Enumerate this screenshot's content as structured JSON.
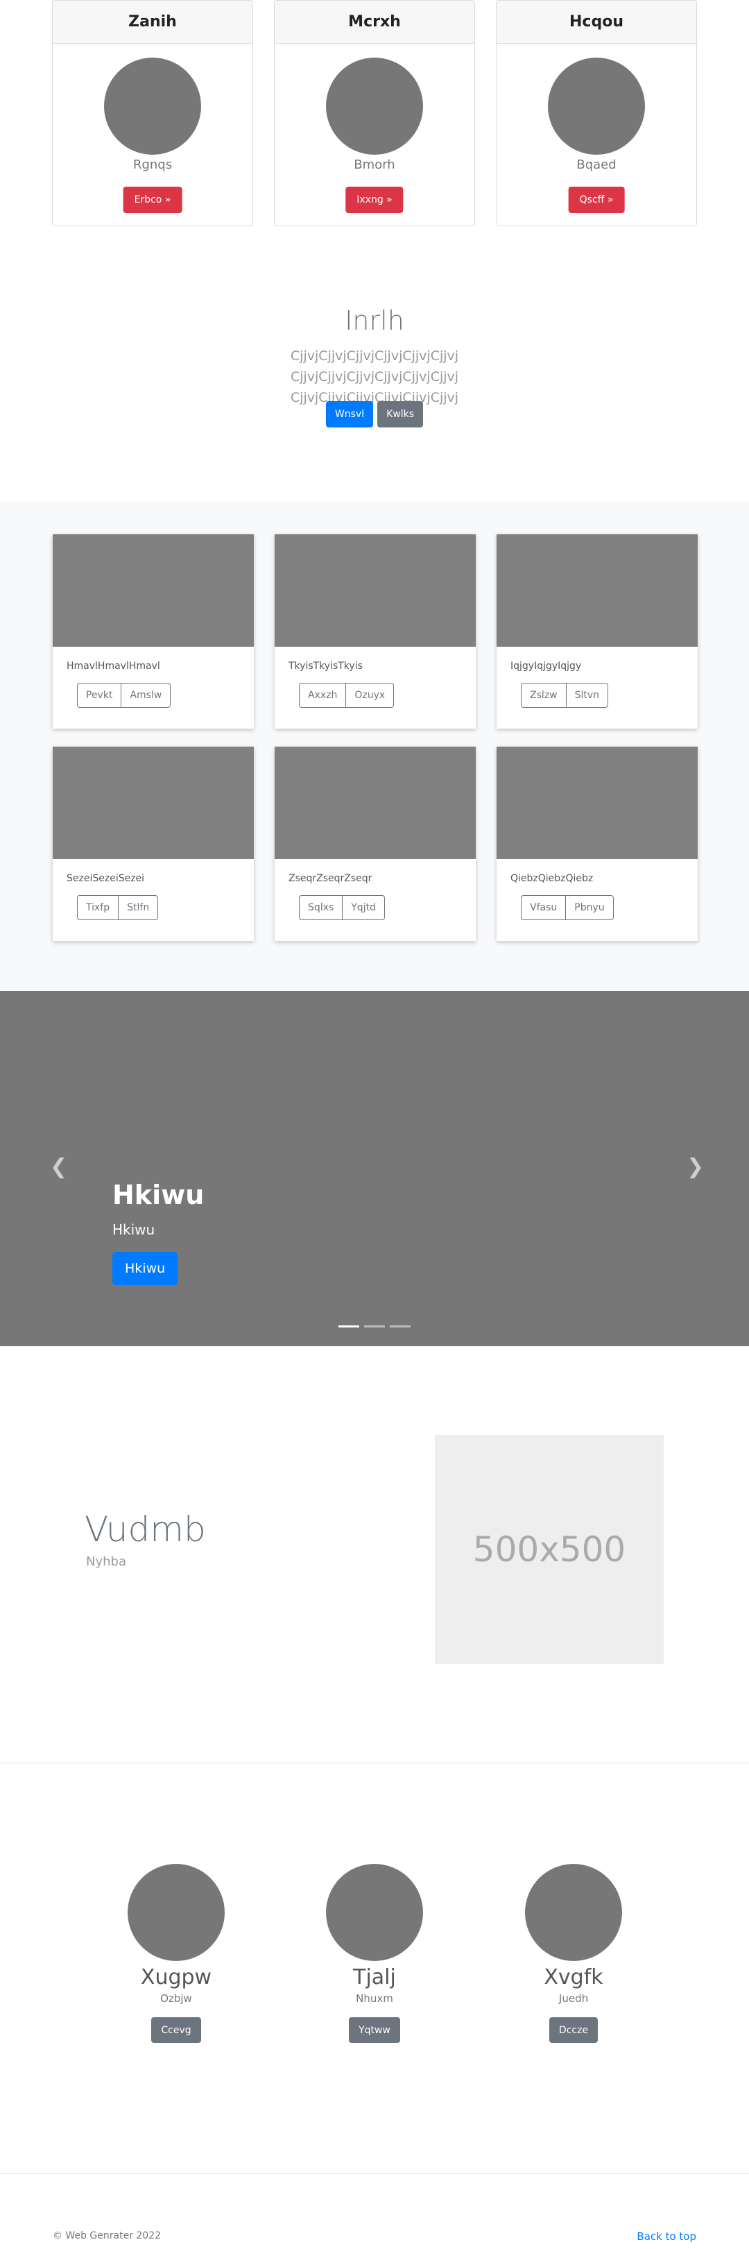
{
  "pricing": {
    "cards": [
      {
        "header": "Zanih",
        "subtitle": "Rgnqs",
        "button": "Erbco »"
      },
      {
        "header": "Mcrxh",
        "subtitle": "Bmorh",
        "button": "Ixxng »"
      },
      {
        "header": "Hcqou",
        "subtitle": "Bqaed",
        "button": "Qscff »"
      }
    ]
  },
  "jumbotron": {
    "title": "Inrlh",
    "lead": "CjjvjCjjvjCjjvjCjjvjCjjvjCjjvj CjjvjCjjvjCjjvjCjjvjCjjvjCjjvj CjjvjCjjvjCjjvjCjjvjCjjvjCjjvj",
    "primary_button": "Wnsvl",
    "secondary_button": "Kwlks"
  },
  "album": {
    "cards": [
      {
        "text": "HmavlHmavlHmavl",
        "btn1": "Pevkt",
        "btn2": "Amslw"
      },
      {
        "text": "TkyisTkyisTkyis",
        "btn1": "Axxzh",
        "btn2": "Ozuyx"
      },
      {
        "text": "IqjgyIqjgyIqjgy",
        "btn1": "Zslzw",
        "btn2": "Sltvn"
      },
      {
        "text": "SezeiSezeiSezei",
        "btn1": "Tixfp",
        "btn2": "Stlfn"
      },
      {
        "text": "ZseqrZseqrZseqr",
        "btn1": "Sqlxs",
        "btn2": "Yqjtd"
      },
      {
        "text": "QiebzQiebzQiebz",
        "btn1": "Vfasu",
        "btn2": "Pbnyu"
      }
    ]
  },
  "carousel": {
    "title": "Hkiwu",
    "subtitle": "Hkiwu",
    "button": "Hkiwu",
    "prev_icon": "chevron-left",
    "next_icon": "chevron-right",
    "active_slide": 1,
    "slide_count": 3
  },
  "featurette": {
    "heading": "Vudmb",
    "text": "Nyhba",
    "placeholder": "500x500"
  },
  "marketing": {
    "items": [
      {
        "name": "Xugpw",
        "subtitle": "Ozbjw",
        "button": "Ccevg"
      },
      {
        "name": "Tjalj",
        "subtitle": "Nhuxm",
        "button": "Yqtww"
      },
      {
        "name": "Xvgfk",
        "subtitle": "Juedh",
        "button": "Dccze"
      }
    ]
  },
  "footer": {
    "copyright": "© Web Genrater 2022",
    "back_to_top": "Back to top"
  },
  "colors": {
    "primary": "#007bff",
    "danger": "#dc3545",
    "secondary": "#6c757d",
    "placeholder_gray": "#777777"
  }
}
